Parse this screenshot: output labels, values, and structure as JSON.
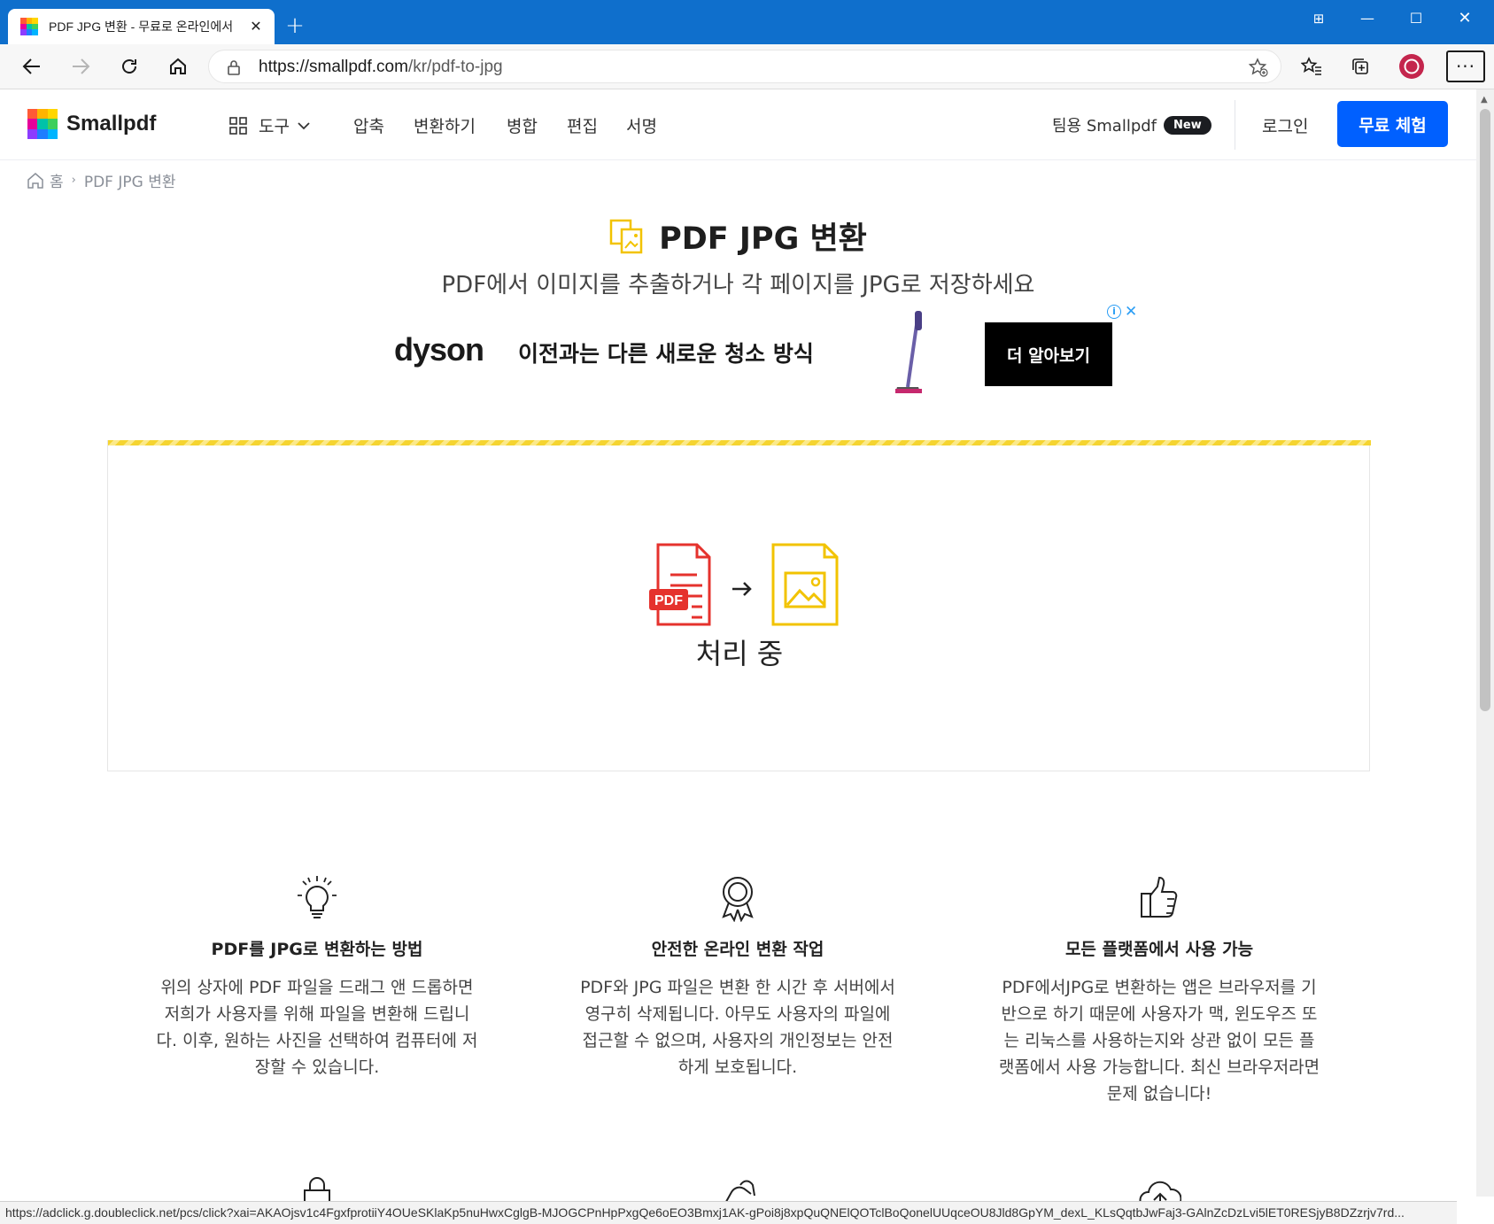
{
  "browser": {
    "tab_title": "PDF JPG 변환 - 무료로 온라인에서",
    "url_prefix": "https://smallpdf.com",
    "url_path": "/kr/pdf-to-jpg",
    "status_url": "https://adclick.g.doubleclick.net/pcs/click?xai=AKAOjsv1c4FgxfprotiiY4OUeSKlaKp5nuHwxCglgB-MJOGCPnHpPxgQe6oEO3Bmxj1AK-gPoi8j8xpQuQNElQOTclBoQonelUUqceOU8Jld8GpYM_dexL_KLsQqtbJwFaj3-GAlnZcDzLvi5lET0RESjyB8DZzrjv7rd..."
  },
  "header": {
    "logo_text": "Smallpdf",
    "tools_label": "도구",
    "nav": [
      "압축",
      "변환하기",
      "병합",
      "편집",
      "서명"
    ],
    "teams_label": "팀용 Smallpdf",
    "new_badge": "New",
    "login_label": "로그인",
    "trial_label": "무료 체험"
  },
  "breadcrumb": {
    "home": "홈",
    "current": "PDF JPG 변환"
  },
  "hero": {
    "title": "PDF JPG 변환",
    "subtitle": "PDF에서 이미지를 추출하거나 각 페이지를 JPG로 저장하세요"
  },
  "ad": {
    "brand": "dyson",
    "text": "이전과는 다른 새로운 청소 방식",
    "cta": "더 알아보기"
  },
  "dropzone": {
    "pdf_tag": "PDF",
    "status": "처리 중"
  },
  "features": [
    {
      "title": "PDF를 JPG로 변환하는 방법",
      "body": "위의 상자에 PDF 파일을 드래그 앤 드롭하면 저희가 사용자를 위해 파일을 변환해 드립니다. 이후, 원하는 사진을 선택하여 컴퓨터에 저장할 수 있습니다."
    },
    {
      "title": "안전한 온라인 변환 작업",
      "body": "PDF와 JPG 파일은 변환 한 시간 후 서버에서 영구히 삭제됩니다. 아무도 사용자의 파일에 접근할 수 없으며, 사용자의 개인정보는 안전하게 보호됩니다."
    },
    {
      "title": "모든 플랫폼에서 사용 가능",
      "body": "PDF에서JPG로 변환하는 앱은 브라우저를 기반으로 하기 때문에 사용자가 맥, 윈도우즈 또는 리눅스를 사용하는지와 상관 없이 모든 플랫폼에서 사용 가능합니다. 최신 브라우저라면 문제 없습니다!"
    }
  ],
  "colors": {
    "browser_blue": "#0f6fcc",
    "cta_blue": "#0060ff",
    "pdf_red": "#e5322d",
    "jpg_yellow": "#f2c300"
  }
}
